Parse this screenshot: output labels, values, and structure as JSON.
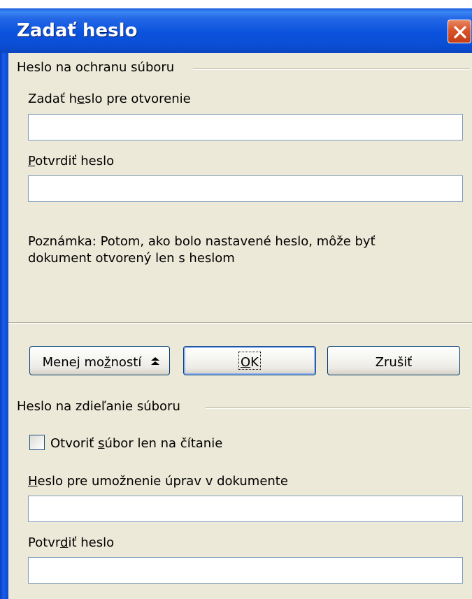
{
  "window": {
    "title": "Zadať heslo",
    "close_icon": "close-icon"
  },
  "file_protection": {
    "group_label": "Heslo na ochranu súboru",
    "open_password": {
      "label_pre": "Zadať h",
      "label_key": "e",
      "label_post": "slo pre otvorenie",
      "value": ""
    },
    "confirm_password": {
      "label_key": "P",
      "label_post": "otvrdiť heslo",
      "value": ""
    },
    "note_line1": "Poznámka: Potom, ako bolo nastavené heslo, môže byť",
    "note_line2": "dokument otvorený len s heslom"
  },
  "buttons": {
    "less_options": {
      "label_pre": "Menej mo",
      "label_key": "ž",
      "label_post": "ností",
      "icon": "double-chevron-up-icon"
    },
    "ok": {
      "label_key": "O",
      "label_post": "K"
    },
    "cancel": {
      "label": "Zrušiť"
    }
  },
  "file_sharing": {
    "group_label": "Heslo na zdieľanie súboru",
    "read_only_checkbox": {
      "label_pre": "Otvoriť ",
      "label_key": "s",
      "label_post": "úbor len na čítanie",
      "checked": false
    },
    "edit_password": {
      "label_key": "H",
      "label_post": "eslo pre umožnenie úprav v dokumente",
      "value": ""
    },
    "confirm_password": {
      "label_pre": "Potvr",
      "label_key": "d",
      "label_post": "iť heslo",
      "value": ""
    }
  }
}
